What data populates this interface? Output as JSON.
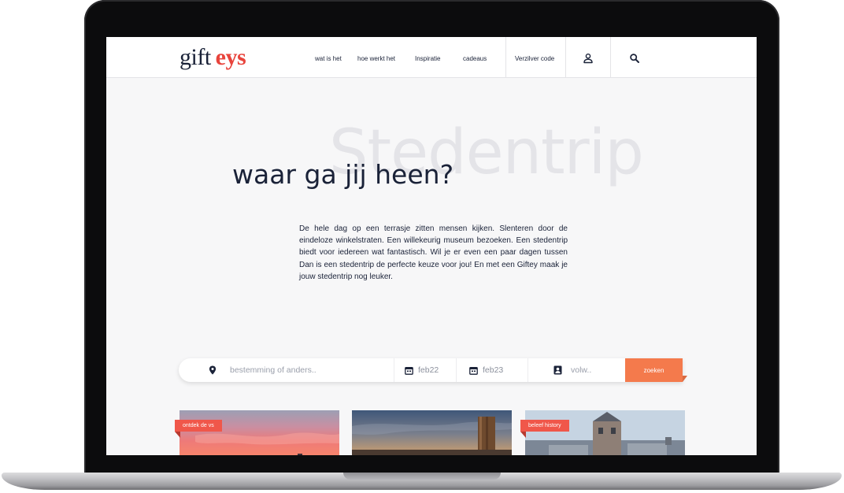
{
  "header": {
    "logo_part1": "gift",
    "logo_part2": "eys",
    "nav": [
      "wat is het",
      "hoe werkt het",
      "Inspiratie",
      "cadeaus"
    ],
    "redeem_label": "Verzilver code",
    "account_icon": "user-icon",
    "search_icon": "search-icon"
  },
  "hero": {
    "background_word": "Stedentrip",
    "title": "waar ga jij heen?",
    "body": "De hele dag op een terrasje zitten mensen kijken. Slenteren door de eindeloze winkelstraten. Een willekeurig museum bezoeken. Een stedentrip biedt voor iedereen wat fantastisch. Wil je er even een paar dagen tussen Dan is een stedentrip de perfecte keuze voor jou! En met een Giftey maak je jouw stedentrip nog leuker."
  },
  "search": {
    "destination_placeholder": "bestemming of anders..",
    "date_from": "feb22",
    "date_to": "feb23",
    "guests_placeholder": "volw..",
    "button_label": "zoeken",
    "icons": [
      "location-pin-icon",
      "calendar-icon",
      "calendar-icon",
      "person-icon"
    ]
  },
  "cards": [
    {
      "tag": "ontdek de vs"
    },
    {
      "tag": ""
    },
    {
      "tag": "beleef history"
    }
  ],
  "colors": {
    "brand_red": "#e8443c",
    "navy": "#1a2238",
    "search_button": "#f47a4c",
    "tag_red": "#f0574a"
  }
}
